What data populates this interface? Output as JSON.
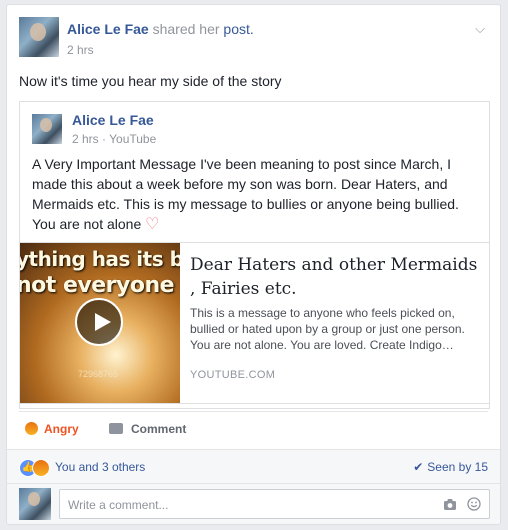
{
  "post": {
    "author": "Alice Le Fae",
    "action": "shared her",
    "action_link": "post.",
    "time": "2 hrs",
    "message": "Now it's time you hear my side of the story"
  },
  "shared": {
    "author": "Alice Le Fae",
    "meta": "2 hrs · YouTube",
    "body": "A Very Important Message I've been meaning to post since March, I made this about a week before my son was born. Dear Haters, and Mermaids etc. This is my message to bullies or anyone being bullied. You are not alone",
    "heart": "♡"
  },
  "link_card": {
    "thumb_text_1": "ything has its bea",
    "thumb_text_2": "not everyone sees",
    "thumb_watermark": "72968765",
    "title": "Dear Haters and other Mermaids , Fairies etc.",
    "description": "This is a message to anyone who feels picked on, bullied or hated upon by a group or just one person. You are not alone. You are loved. Create Indigo…",
    "domain": "YOUTUBE.COM"
  },
  "actions": {
    "angry_label": "Angry",
    "comment_label": "Comment"
  },
  "reactions": {
    "summary": "You and 3 others",
    "seen": "Seen by 15"
  },
  "composer": {
    "placeholder": "Write a comment..."
  },
  "colors": {
    "link": "#365899",
    "angry": "#f05223",
    "muted": "#90949c"
  }
}
